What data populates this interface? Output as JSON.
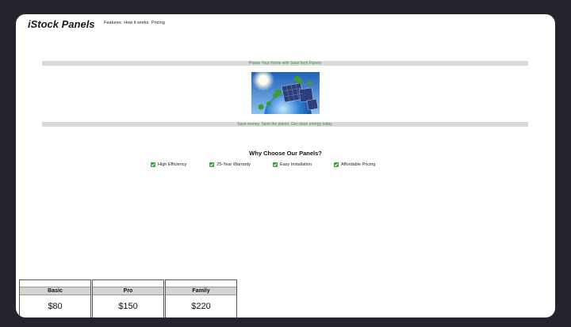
{
  "header": {
    "logo": "iStock Panels",
    "nav": [
      "Features",
      "How it works",
      "Pricing"
    ]
  },
  "hero": {
    "title": "Power Your Home with SolarTech Panels",
    "image": "solar-panels-on-globe-image",
    "tagline": "Save money. Save the planet. Get clean energy today."
  },
  "features": {
    "heading": "Why Choose Our Panels?",
    "items": [
      "High Efficiency",
      "25-Year Warranty",
      "Easy Installation",
      "Affordable Pricing"
    ],
    "icon": "check-mark-icon",
    "accent": "#3aa53a"
  },
  "pricing": {
    "plans": [
      {
        "name": "Basic",
        "price": "$80"
      },
      {
        "name": "Pro",
        "price": "$150"
      },
      {
        "name": "Family",
        "price": "$220"
      }
    ]
  },
  "colors": {
    "background": "#24242c",
    "page": "#ffffff",
    "banner": "#d9d9d9",
    "banner_text": "#3f8f3f"
  }
}
